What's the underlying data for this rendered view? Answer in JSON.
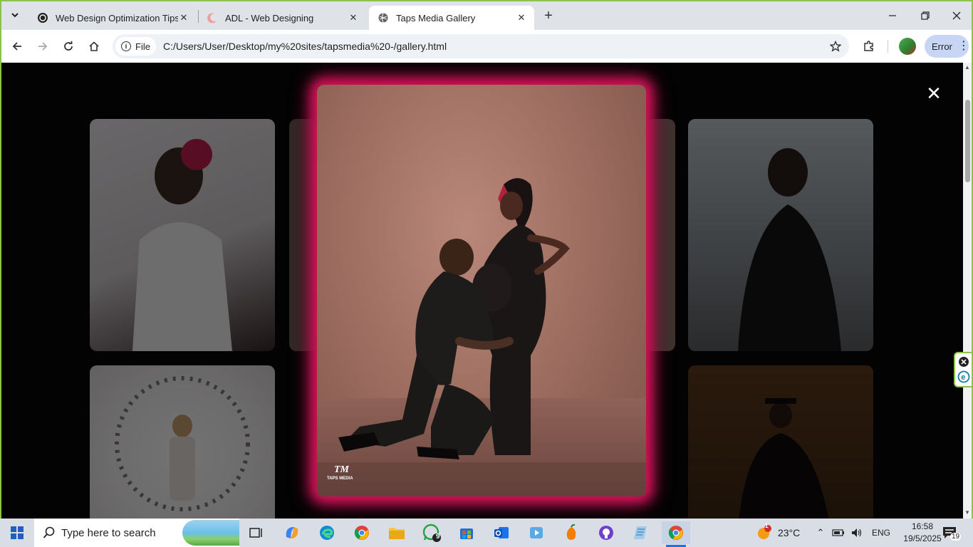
{
  "browser": {
    "tabs": [
      {
        "title": "Web Design Optimization Tips",
        "favicon": "openai-icon",
        "active": false
      },
      {
        "title": "ADL - Web Designing",
        "favicon": "moon-icon",
        "active": false
      },
      {
        "title": "Taps Media Gallery",
        "favicon": "globe-icon",
        "active": true
      }
    ],
    "address": {
      "scheme_label": "File",
      "url": "C:/Users/User/Desktop/my%20sites/tapsmedia%20-/gallery.html"
    },
    "profile_button": {
      "label": "Error"
    }
  },
  "page": {
    "lightbox": {
      "photo_description_icon": "couple-maternity-photo",
      "watermark": "TM",
      "watermark_sub": "TAPS MEDIA",
      "close_label": "✕"
    }
  },
  "taskbar": {
    "search_placeholder": "Type here to search",
    "weather": {
      "temperature": "23°C",
      "alert_count": "1"
    },
    "language": "ENG",
    "time": "16:58",
    "date": "19/5/2025",
    "whatsapp_badge": "9",
    "notification_count": "19"
  },
  "colors": {
    "window_border": "#8bc34a",
    "lightbox_glow": "#d6135b",
    "accent": "#1a73e8"
  }
}
